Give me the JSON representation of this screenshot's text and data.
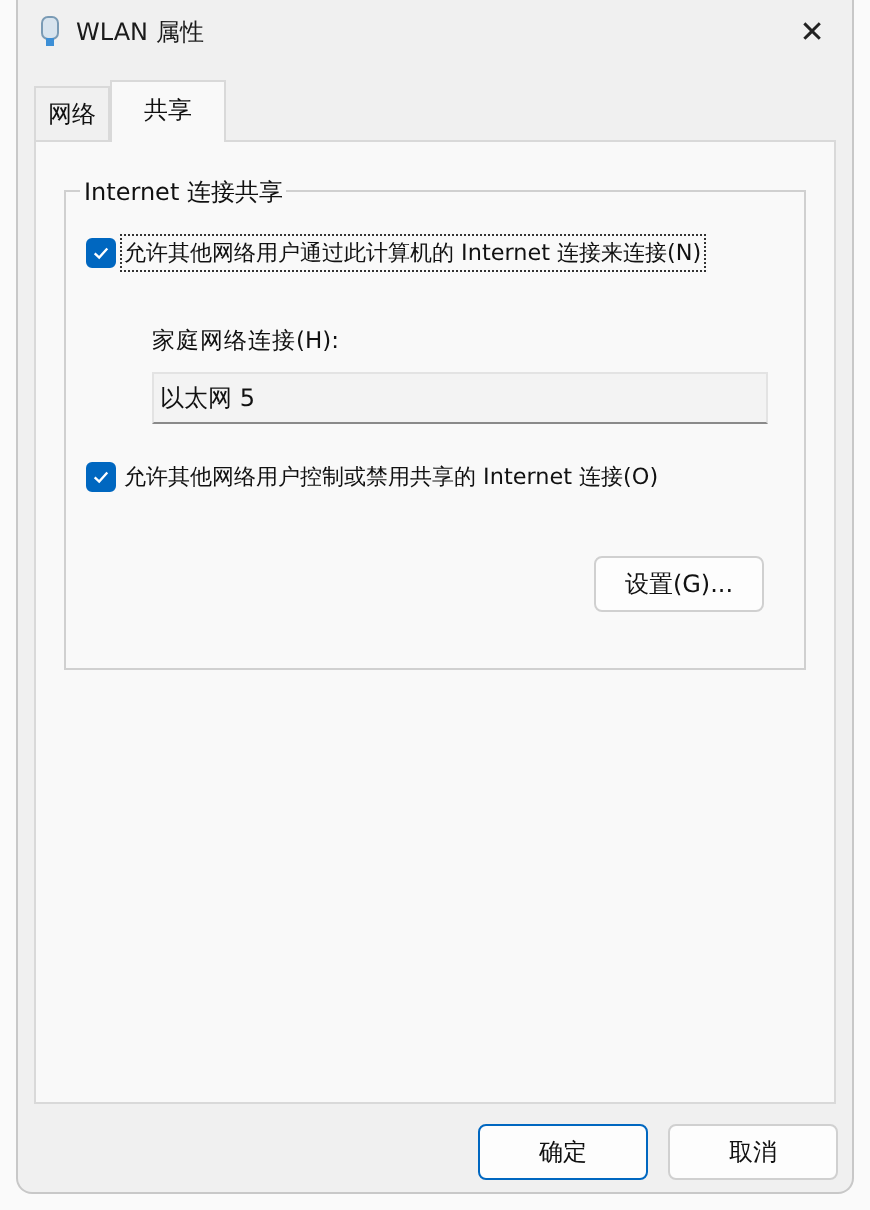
{
  "window": {
    "title": "WLAN 属性",
    "close": "✕"
  },
  "tabs": [
    {
      "label": "网络",
      "selected": false
    },
    {
      "label": "共享",
      "selected": true
    }
  ],
  "group": {
    "title": "Internet 连接共享",
    "options": [
      {
        "kind": "checkbox",
        "label": "允许其他网络用户通过此计算机的 Internet 连接来连接(N)",
        "checked": true,
        "focused": true
      },
      {
        "kind": "field",
        "label": "家庭网络连接(H):",
        "value": "以太网 5"
      },
      {
        "kind": "checkbox",
        "label": "允许其他网络用户控制或禁用共享的 Internet 连接(O)",
        "checked": true,
        "focused": false
      }
    ],
    "settings_button": "设置(G)..."
  },
  "buttons": [
    {
      "label": "确定",
      "default": true
    },
    {
      "label": "取消",
      "default": false
    }
  ]
}
